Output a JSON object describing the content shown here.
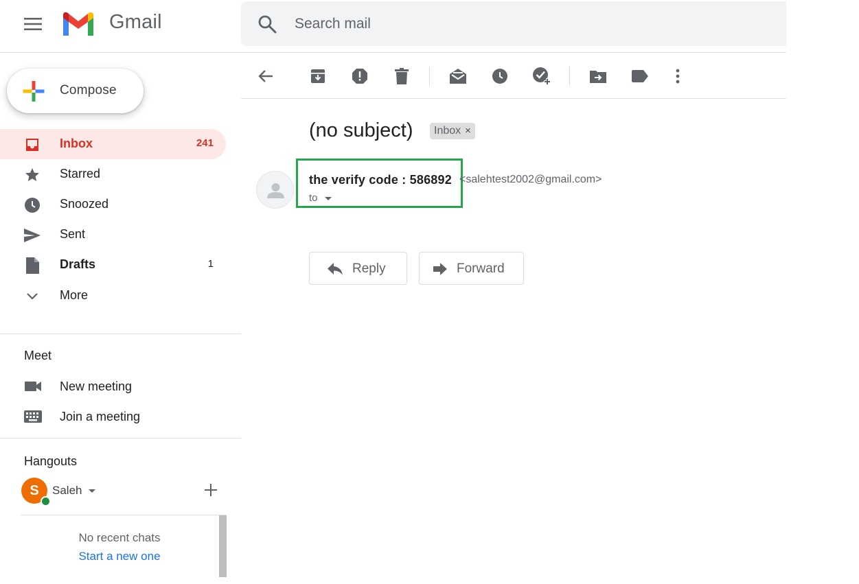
{
  "header": {
    "logo_text": "Gmail",
    "search_placeholder": "Search mail"
  },
  "sidebar": {
    "compose_label": "Compose",
    "nav": [
      {
        "label": "Inbox",
        "count": "241",
        "icon": "inbox-icon"
      },
      {
        "label": "Starred",
        "count": "",
        "icon": "star-icon"
      },
      {
        "label": "Snoozed",
        "count": "",
        "icon": "clock-icon"
      },
      {
        "label": "Sent",
        "count": "",
        "icon": "send-icon"
      },
      {
        "label": "Drafts",
        "count": "1",
        "icon": "draft-icon"
      },
      {
        "label": "More",
        "count": "",
        "icon": "chevron-down-icon"
      }
    ],
    "meet": {
      "title": "Meet",
      "items": [
        {
          "label": "New meeting",
          "icon": "video-camera-icon"
        },
        {
          "label": "Join a meeting",
          "icon": "keyboard-icon"
        }
      ]
    },
    "hangouts": {
      "title": "Hangouts",
      "user_initial": "S",
      "user_name": "Saleh",
      "no_chats": "No recent chats",
      "start_chat": "Start a new one"
    }
  },
  "toolbar": {
    "buttons": [
      "back-icon",
      "archive-icon",
      "report-spam-icon",
      "delete-icon",
      "mark-unread-icon",
      "snooze-icon",
      "add-to-tasks-icon",
      "move-to-icon",
      "label-icon",
      "more-options-icon"
    ]
  },
  "message": {
    "subject": "(no subject)",
    "chip_label": "Inbox",
    "chip_close": "×",
    "sender_name": "the verify code : 586892",
    "sender_email": "<salehtest2002@gmail.com>",
    "to_label": "to",
    "reply_label": "Reply",
    "forward_label": "Forward"
  },
  "colors": {
    "accent_red": "#d93025",
    "active_bg": "#fce8e6",
    "highlight_green": "#22a84a",
    "link_blue": "#1a73e8",
    "avatar_orange": "#ef6c00",
    "online_green": "#1e8e3e"
  }
}
